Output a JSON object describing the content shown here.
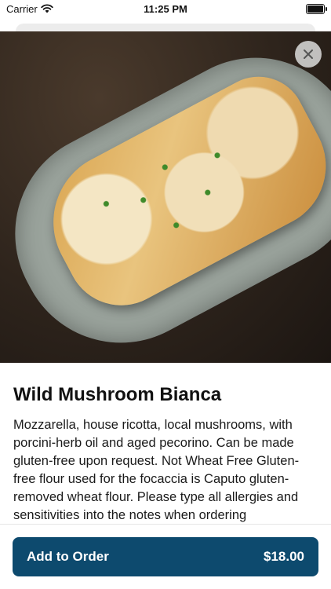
{
  "status_bar": {
    "carrier": "Carrier",
    "time": "11:25 PM"
  },
  "item": {
    "title": "Wild Mushroom Bianca",
    "description": "Mozzarella, house ricotta, local mushrooms, with porcini-herb oil and aged pecorino. Can be made gluten-free upon request. Not Wheat Free Gluten-free flour used for the focaccia is Caputo gluten-removed wheat flour. Please type all allergies and sensitivities into the notes when ordering"
  },
  "order_button": {
    "label": "Add to Order",
    "price": "$18.00",
    "color": "#0d4a6e"
  },
  "icons": {
    "close": "close-icon",
    "wifi": "wifi-icon",
    "battery": "battery-icon"
  }
}
